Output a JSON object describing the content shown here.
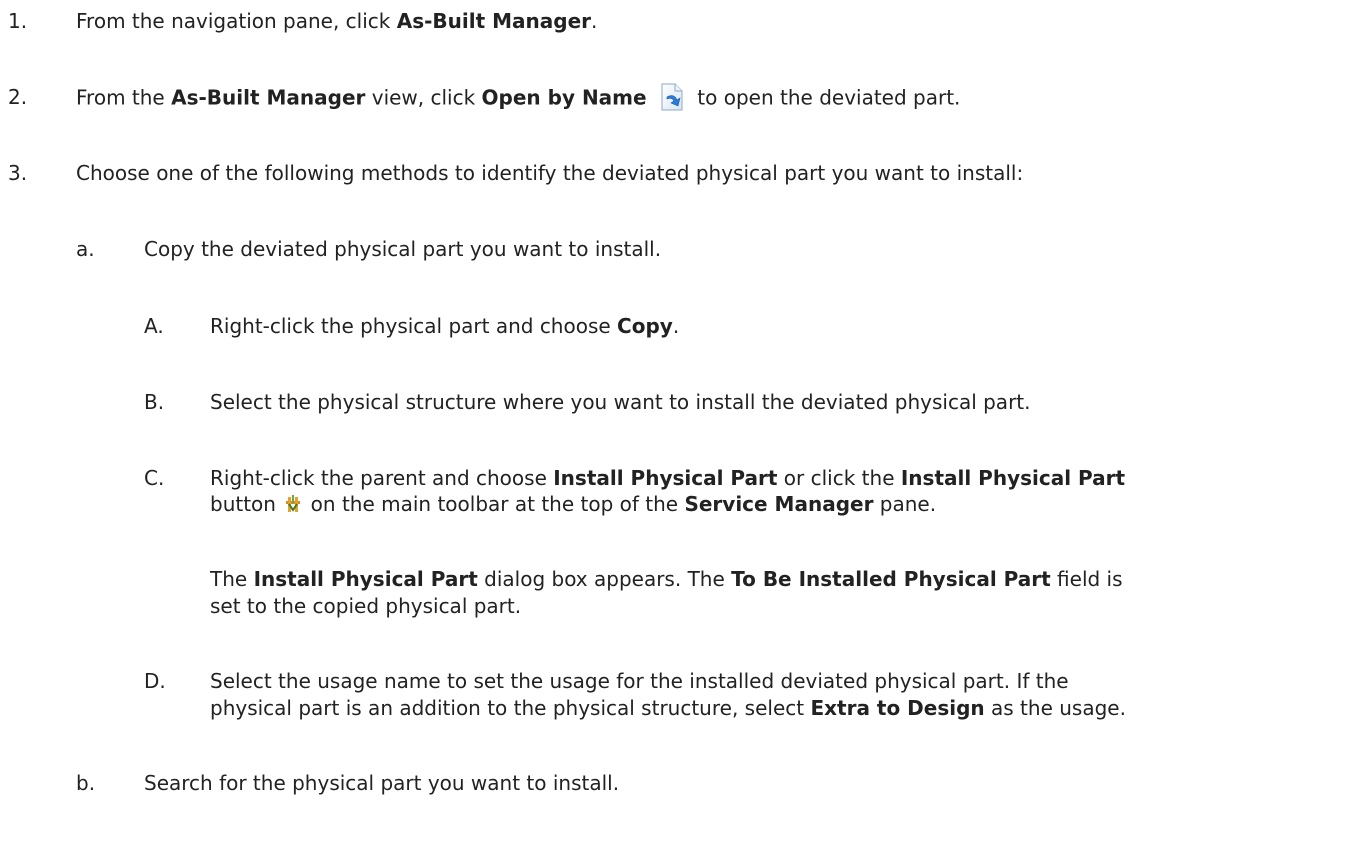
{
  "steps": [
    {
      "marker": "1.",
      "parts": {
        "t1": "From the navigation pane, click ",
        "b1": "As-Built Manager",
        "t2": "."
      }
    },
    {
      "marker": "2.",
      "parts": {
        "t1": "From the ",
        "b1": "As-Built Manager",
        "t2": " view, click ",
        "b2": "Open by Name",
        "t3": " to open the deviated part."
      },
      "icon": "open-by-name-icon"
    },
    {
      "marker": "3.",
      "parts": {
        "t1": "Choose one of the following methods to identify the deviated physical part you want to install:"
      }
    }
  ],
  "substeps": [
    {
      "marker": "a.",
      "text": "Copy the deviated physical part you want to install."
    },
    {
      "marker": "b.",
      "text": "Search for the physical part you want to install."
    }
  ],
  "subsubsteps": [
    {
      "marker": "A.",
      "parts": {
        "t1": "Right-click the physical part and choose ",
        "b1": "Copy",
        "t2": "."
      }
    },
    {
      "marker": "B.",
      "parts": {
        "t1": "Select the physical structure where you want to install the deviated physical part."
      }
    },
    {
      "marker": "C.",
      "parts": {
        "t1": "Right-click the parent and choose ",
        "b1": "Install Physical Part",
        "t2": " or click the ",
        "b2": "Install Physical Part",
        "t3": "button",
        "t4": " on the main toolbar at the top of the ",
        "b3": "Service Manager",
        "t5": " pane."
      },
      "icon": "install-physical-part-icon",
      "note": {
        "t1": "The ",
        "b1": "Install Physical Part",
        "t2": " dialog box appears. The ",
        "b2": "To Be Installed Physical Part",
        "t3": " field is",
        "t4": "set to the copied physical part."
      }
    },
    {
      "marker": "D.",
      "parts": {
        "t1": "Select the usage name to set the usage for the installed deviated physical part. If the",
        "t2": "physical part is an addition to the physical structure, select ",
        "b1": "Extra to Design",
        "t3": " as the usage."
      }
    }
  ]
}
